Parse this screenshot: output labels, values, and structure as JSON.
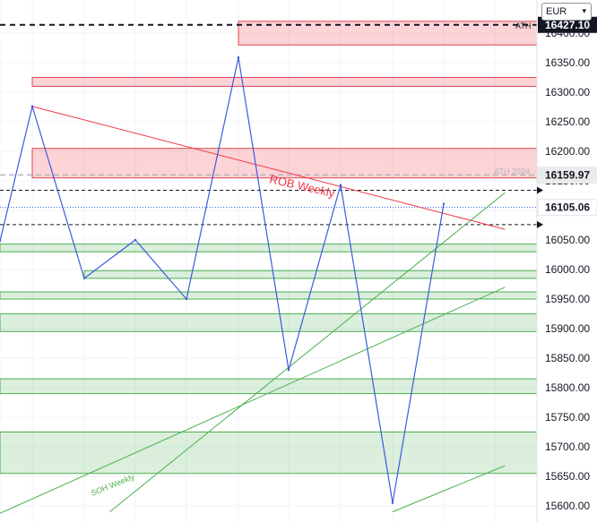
{
  "currency": {
    "label": "EUR",
    "chevron": "chevron-down-icon"
  },
  "chart_data": {
    "type": "line",
    "ylim": [
      15590,
      16427
    ],
    "yticks": [
      15600,
      15650,
      15700,
      15750,
      15800,
      15850,
      15900,
      15950,
      16000,
      16050,
      16100,
      16150,
      16200,
      16250,
      16300,
      16350,
      16400
    ],
    "series": [
      {
        "color": "#3b5bdb",
        "x": [
          0,
          1,
          2,
          3,
          4,
          5,
          6,
          7,
          8,
          9
        ],
        "values": [
          16048,
          16276,
          15985,
          16050,
          15950,
          16359,
          15830,
          16143,
          15605,
          16111
        ]
      }
    ],
    "resistance_zones": [
      {
        "low": 16380,
        "high": 16420
      },
      {
        "low": 16310,
        "high": 16325
      },
      {
        "low": 16155,
        "high": 16205
      }
    ],
    "support_zones": [
      {
        "low": 16030,
        "high": 16043
      },
      {
        "low": 15985,
        "high": 15998
      },
      {
        "low": 15950,
        "high": 15962
      },
      {
        "low": 15895,
        "high": 15925
      },
      {
        "low": 15790,
        "high": 15815
      },
      {
        "low": 15655,
        "high": 15725
      }
    ],
    "price_labels": [
      {
        "text": "16159.97",
        "value": 16159.97,
        "style": "grey"
      },
      {
        "text": "16105.06",
        "value": 16105.06,
        "style": "white"
      }
    ],
    "price_markers": [
      16134,
      16076
    ],
    "ath": {
      "text": "ATH",
      "value": 16414,
      "label_text": "16427.10"
    },
    "ath_2024": {
      "text": "ATH 2024",
      "value": 16160
    },
    "dotted_line": {
      "value": 16105.06
    },
    "rob_weekly": {
      "text": "ROB Weekly",
      "start": [
        1,
        16276
      ],
      "end": [
        10.2,
        16068
      ]
    },
    "soh_weekly": {
      "text": "SOH Weekly"
    },
    "green_trendlines": [
      {
        "start": [
          -0.3,
          15580
        ],
        "end": [
          10.2,
          15970
        ]
      },
      {
        "start": [
          2.5,
          15590
        ],
        "end": [
          10.2,
          16130
        ]
      },
      {
        "start": [
          8,
          15590
        ],
        "end": [
          10.2,
          15668
        ]
      }
    ]
  }
}
